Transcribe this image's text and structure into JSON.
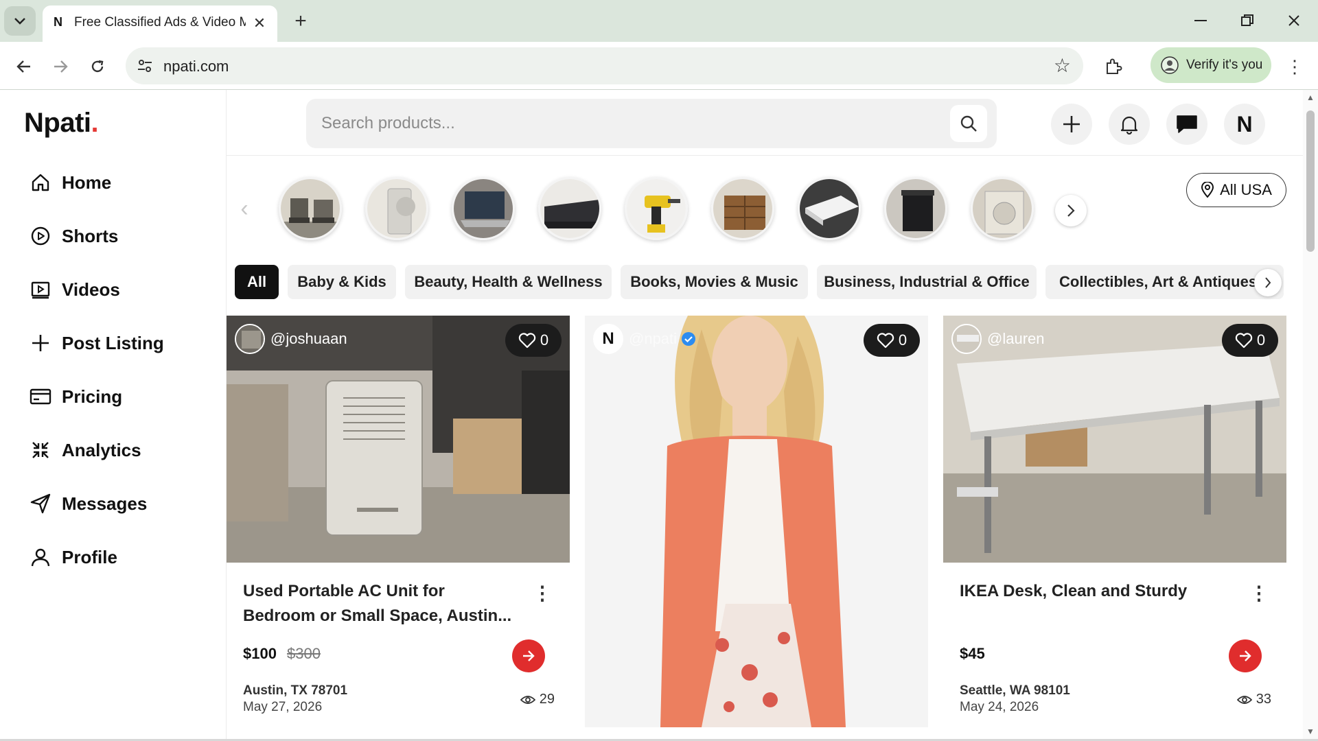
{
  "browser": {
    "tab_title": "Free Classified Ads & Video Ma",
    "tab_favicon": "N",
    "url": "npati.com",
    "verify_label": "Verify it's you"
  },
  "app": {
    "logo_text": "Npati",
    "logo_dot": ".",
    "accent_color": "#e02d2d"
  },
  "sidebar": {
    "items": [
      {
        "label": "Home",
        "icon": "home-icon"
      },
      {
        "label": "Shorts",
        "icon": "play-circle-icon"
      },
      {
        "label": "Videos",
        "icon": "video-icon"
      },
      {
        "label": "Post Listing",
        "icon": "plus-icon"
      },
      {
        "label": "Pricing",
        "icon": "credit-card-icon"
      },
      {
        "label": "Analytics",
        "icon": "analytics-icon"
      },
      {
        "label": "Messages",
        "icon": "send-icon"
      },
      {
        "label": "Profile",
        "icon": "user-icon"
      }
    ]
  },
  "header": {
    "search_placeholder": "Search products...",
    "avatar_letter": "N"
  },
  "location": {
    "label": "All USA"
  },
  "categories": [
    "All",
    "Baby & Kids",
    "Beauty, Health & Wellness",
    "Books, Movies & Music",
    "Business, Industrial & Office",
    "Collectibles, Art & Antiques"
  ],
  "listings": [
    {
      "username": "@joshuaan",
      "likes": "0",
      "title": "Used Portable AC Unit for Bedroom or Small Space, Austin...",
      "price": "$100",
      "old_price": "$300",
      "location": "Austin, TX 78701",
      "date": "May 27, 2026",
      "views": "29"
    },
    {
      "username": "@npati",
      "avatar_letter": "N",
      "likes": "0"
    },
    {
      "username": "@lauren",
      "likes": "0",
      "title": "IKEA Desk, Clean and Sturdy",
      "price": "$45",
      "location": "Seattle, WA 98101",
      "date": "May 24, 2026",
      "views": "33"
    }
  ]
}
